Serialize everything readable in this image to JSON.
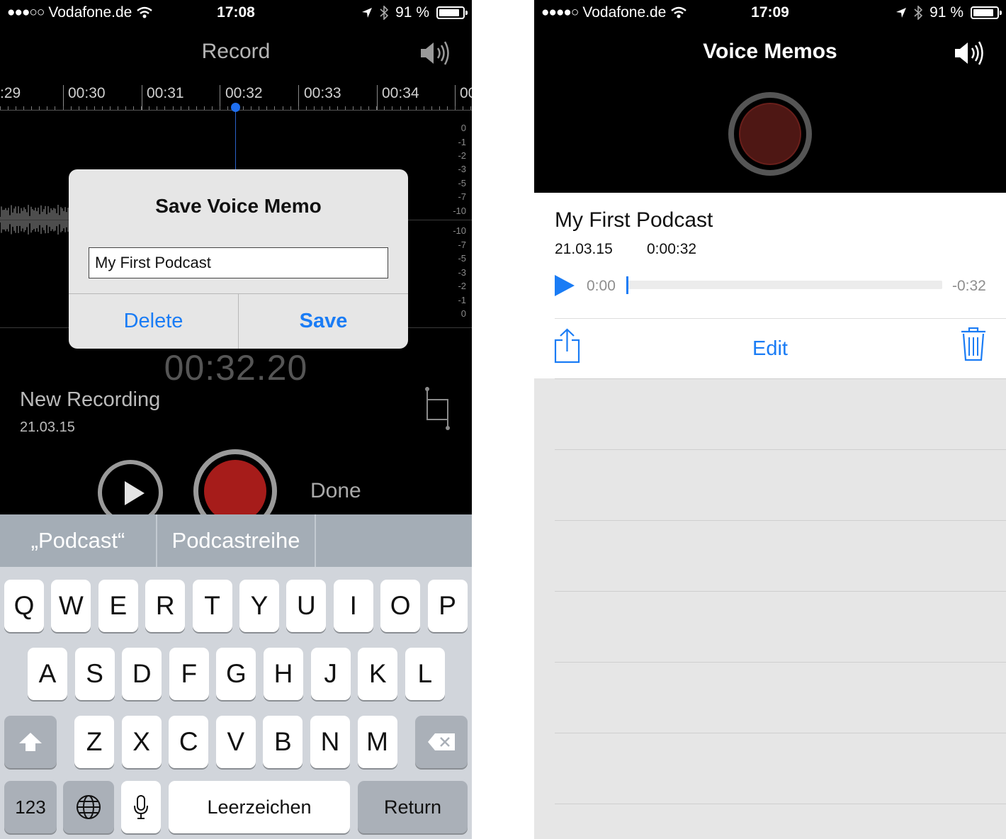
{
  "left": {
    "status": {
      "signal": "●●●○○",
      "carrier": "Vodafone.de",
      "time": "17:08",
      "battery": "91 %"
    },
    "nav_title": "Record",
    "timeline_labels": [
      ":29",
      "00:30",
      "00:31",
      "00:32",
      "00:33",
      "00:34",
      "00"
    ],
    "db_top": [
      "0",
      "-1",
      "-2",
      "-3",
      "-5",
      "-7",
      "-10"
    ],
    "db_bottom": [
      "-10",
      "-7",
      "-5",
      "-3",
      "-2",
      "-1",
      "0"
    ],
    "dialog": {
      "title": "Save Voice Memo",
      "field_value": "My First Podcast",
      "delete_label": "Delete",
      "save_label": "Save"
    },
    "timer": "00:32.20",
    "recording_name": "New Recording",
    "recording_date": "21.03.15",
    "done_label": "Done",
    "suggestions": [
      "„Podcast“",
      "Podcastreihe",
      ""
    ],
    "keyboard": {
      "row1": [
        "Q",
        "W",
        "E",
        "R",
        "T",
        "Y",
        "U",
        "I",
        "O",
        "P"
      ],
      "row2": [
        "A",
        "S",
        "D",
        "F",
        "G",
        "H",
        "J",
        "K",
        "L"
      ],
      "row3": [
        "Z",
        "X",
        "C",
        "V",
        "B",
        "N",
        "M"
      ],
      "numbers_label": "123",
      "space_label": "Leerzeichen",
      "return_label": "Return"
    }
  },
  "right": {
    "status": {
      "signal": "●●●●○",
      "carrier": "Vodafone.de",
      "time": "17:09",
      "battery": "91 %"
    },
    "nav_title": "Voice Memos",
    "memo": {
      "title": "My First Podcast",
      "date": "21.03.15",
      "duration": "0:00:32",
      "elapsed": "0:00",
      "remaining": "-0:32",
      "progress": 0
    },
    "edit_label": "Edit"
  },
  "colors": {
    "ios_blue": "#1a7cf5",
    "record_red": "#a61c1a",
    "record_red_inactive": "#4e1714",
    "keyboard_bg": "#d1d5db",
    "suggestion_bar": "#a4adb6"
  }
}
